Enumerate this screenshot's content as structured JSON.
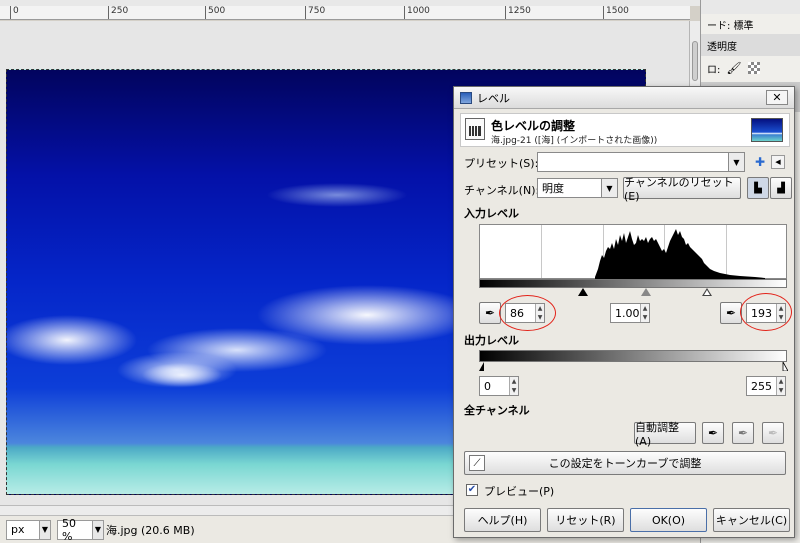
{
  "ruler": {
    "ticks": [
      "0",
      "250",
      "500",
      "750",
      "1000",
      "1250",
      "1500"
    ]
  },
  "statusbar": {
    "unit": "px",
    "zoom": "50 %",
    "filename": "海.jpg (20.6 MB)"
  },
  "layers_panel": {
    "mode_label": "ード: 標準",
    "opacity_label": "透明度"
  },
  "dialog": {
    "window_title": "レベル",
    "header_title": "色レベルの調整",
    "header_subtitle": "海.jpg-21 ([海] (インポートされた画像))",
    "preset_label": "プリセット(S):",
    "preset_value": "",
    "channel_label": "チャンネル(N):",
    "channel_value": "明度",
    "channel_reset_label": "チャンネルのリセット(E)",
    "input_levels_label": "入力レベル",
    "input_low": "86",
    "input_gamma": "1.00",
    "input_high": "193",
    "output_levels_label": "出力レベル",
    "output_low": "0",
    "output_high": "255",
    "all_channels_label": "全チャンネル",
    "auto_label": "自動調整(A)",
    "curves_label": "この設定をトーンカーブで調整",
    "preview_label": "プレビュー(P)",
    "preview_checked": true,
    "help_label": "ヘルプ(H)",
    "reset_label": "リセット(R)",
    "ok_label": "OK(O)",
    "cancel_label": "キャンセル(C)"
  }
}
